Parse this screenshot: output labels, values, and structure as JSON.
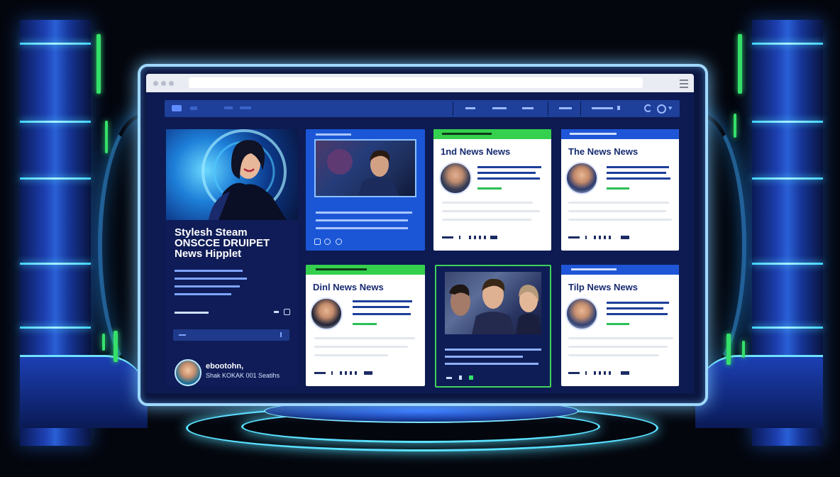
{
  "colors": {
    "accent_green": "#35e06a",
    "accent_blue": "#1b56d6",
    "screen_bg": "#0d1b52",
    "glow_cyan": "#5ae0ff"
  },
  "hero": {
    "title_line1": "Stylesh Steam",
    "title_line2": "ONSCCE DRUIPET",
    "title_line3": "News Hipplet",
    "author_name": "ebootohn,",
    "author_sub": "Shak KOKAK 001 Seatihs"
  },
  "cards": {
    "card2": {
      "title": "1nd News News"
    },
    "card3": {
      "title": "The News News"
    },
    "card4": {
      "title": "Dinl News News"
    },
    "card6": {
      "title": "Tilp News News"
    }
  },
  "icons": {
    "nav_refresh": "refresh-icon",
    "nav_heart": "heart-icon",
    "nav_search": "search-icon",
    "menu": "hamburger-icon"
  }
}
